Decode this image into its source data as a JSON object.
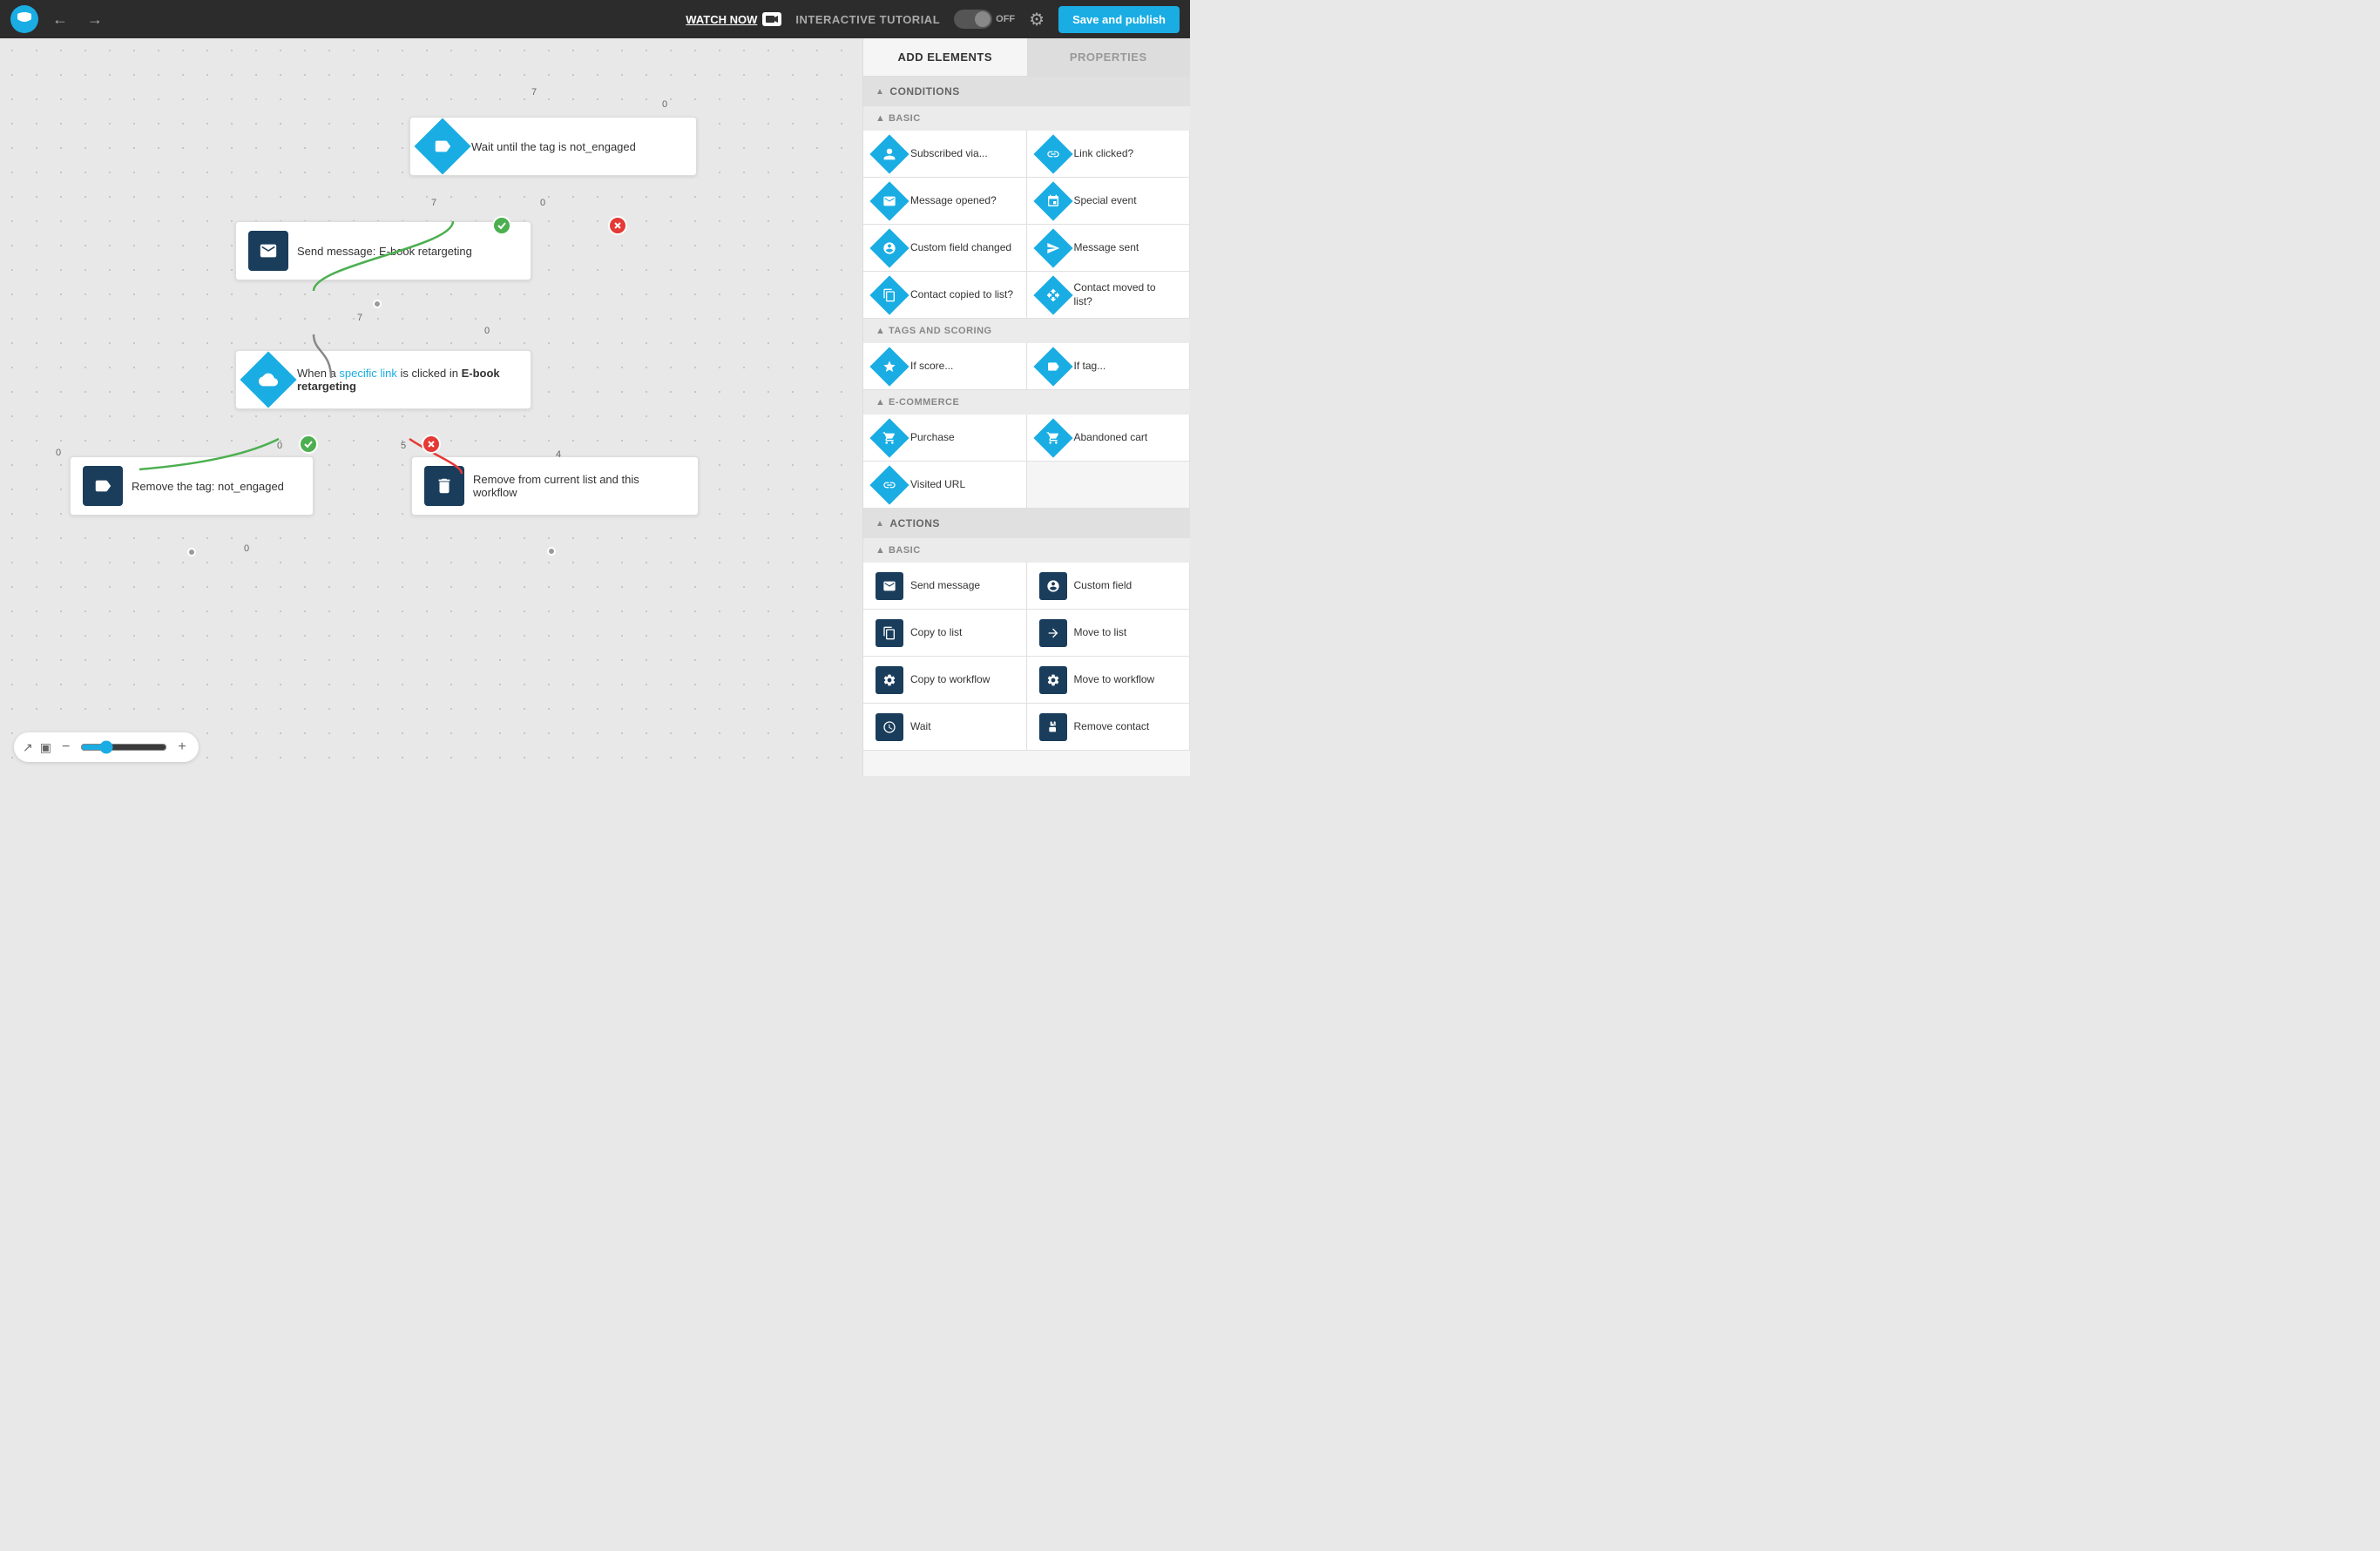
{
  "topnav": {
    "watch_now": "WATCH NOW",
    "interactive_tutorial": "INTERACTIVE TUTORIAL",
    "toggle_state": "OFF",
    "save_label": "Save and publish"
  },
  "panel": {
    "tab_add": "ADD ELEMENTS",
    "tab_properties": "PROPERTIES"
  },
  "conditions_section": "CONDITIONS",
  "basic_label": "BASIC",
  "tags_scoring_label": "TAGS AND SCORING",
  "ecommerce_label": "E-COMMERCE",
  "actions_section": "ACTIONS",
  "actions_basic_label": "BASIC",
  "conditions": {
    "basic": [
      {
        "label": "Subscribed via...",
        "icon": "user"
      },
      {
        "label": "Link clicked?",
        "icon": "link"
      },
      {
        "label": "Message opened?",
        "icon": "envelope"
      },
      {
        "label": "Special event",
        "icon": "calendar"
      },
      {
        "label": "Custom field changed",
        "icon": "user-settings"
      },
      {
        "label": "Message sent",
        "icon": "envelope-sent"
      },
      {
        "label": "Contact copied to list?",
        "icon": "copy-contact"
      },
      {
        "label": "Contact moved to list?",
        "icon": "move-contact"
      }
    ],
    "tags": [
      {
        "label": "If score...",
        "icon": "star"
      },
      {
        "label": "If tag...",
        "icon": "tag"
      }
    ],
    "ecommerce": [
      {
        "label": "Purchase",
        "icon": "cart"
      },
      {
        "label": "Abandoned cart",
        "icon": "cart-abandoned"
      },
      {
        "label": "Visited URL",
        "icon": "link-visited"
      }
    ]
  },
  "actions": {
    "basic": [
      {
        "label": "Send message",
        "icon": "envelope-action"
      },
      {
        "label": "Custom field",
        "icon": "user-action"
      },
      {
        "label": "Copy to list",
        "icon": "copy-list"
      },
      {
        "label": "Move to list",
        "icon": "move-list"
      },
      {
        "label": "Copy to workflow",
        "icon": "copy-workflow"
      },
      {
        "label": "Move to workflow",
        "icon": "move-workflow"
      },
      {
        "label": "Wait",
        "icon": "wait"
      },
      {
        "label": "Remove contact",
        "icon": "remove-contact"
      }
    ]
  },
  "nodes": {
    "wait_tag": "Wait until the tag is not_engaged",
    "send_message": "Send message: E-book retargeting",
    "condition_link": "When a specific link is clicked in E-book retargeting",
    "remove_tag": "Remove the tag: not_engaged",
    "remove_list": "Remove from current list and this workflow"
  },
  "zoom": {
    "value": 60
  }
}
